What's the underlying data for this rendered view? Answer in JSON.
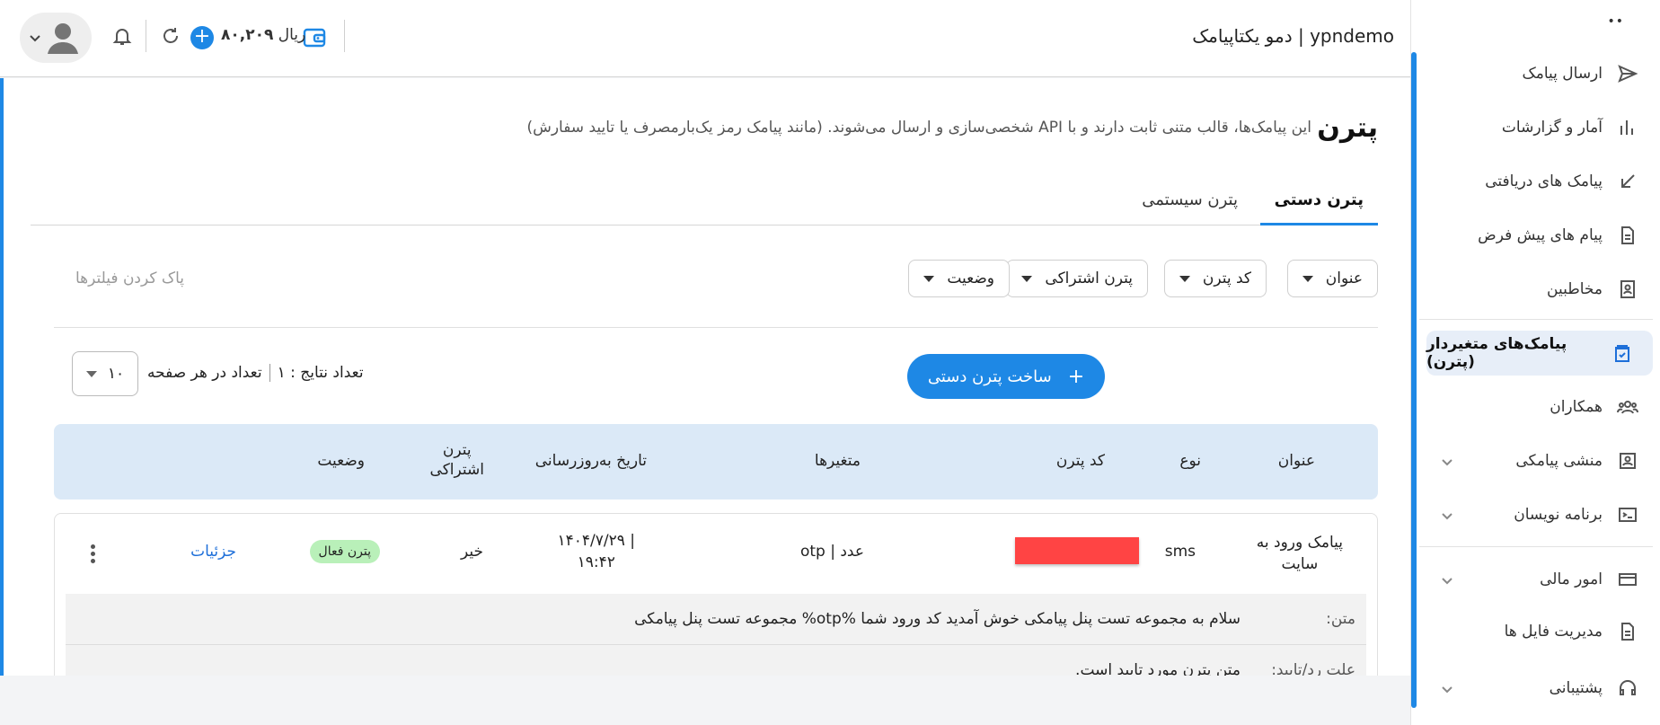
{
  "header": {
    "brand": "دمو یکتاپیامک | ypndemo",
    "balance_value": "۸۰,۲۰۹",
    "balance_unit": "ریال"
  },
  "sidebar": {
    "items": [
      {
        "label": "ارسال پیامک",
        "icon": "send-icon"
      },
      {
        "label": "آمار و گزارشات",
        "icon": "bar-chart-icon"
      },
      {
        "label": "پیامک های دریافتی",
        "icon": "inbox-arrow-icon"
      },
      {
        "label": "پیام های پیش فرض",
        "icon": "document-icon"
      },
      {
        "label": "مخاطبین",
        "icon": "contact-card-icon"
      },
      {
        "label": "پیامک‌های متغیردار (پترن)",
        "icon": "clipboard-check-icon",
        "active": true
      },
      {
        "label": "همکاران",
        "icon": "users-icon"
      },
      {
        "label": "منشی پیامکی",
        "icon": "assistant-icon",
        "expandable": true
      },
      {
        "label": "برنامه نویسان",
        "icon": "terminal-icon",
        "expandable": true
      },
      {
        "label": "امور مالی",
        "icon": "wallet-icon",
        "expandable": true
      },
      {
        "label": "مدیریت فایل ها",
        "icon": "file-icon"
      },
      {
        "label": "پشتیبانی",
        "icon": "headset-icon",
        "expandable": true
      }
    ]
  },
  "page": {
    "title": "پترن",
    "description": "این پیامک‌ها، قالب متنی ثابت دارند و با API شخصی‌سازی و ارسال می‌شوند. (مانند پیامک رمز یک‌بارمصرف یا تایید سفارش)"
  },
  "tabs": [
    {
      "label": "پترن دستی",
      "active": true
    },
    {
      "label": "پترن سیستمی",
      "active": false
    }
  ],
  "filters": {
    "title": "عنوان",
    "code": "کد پترن",
    "shared": "پترن اشتراکی",
    "status": "وضعیت",
    "clear": "پاک کردن فیلترها"
  },
  "toolbar": {
    "create_label": "ساخت پترن دستی",
    "results_label": "تعداد نتایج : ۱",
    "per_page_label": "تعداد در هر صفحه",
    "per_page_value": "۱۰"
  },
  "table": {
    "headers": {
      "title": "عنوان",
      "type": "نوع",
      "code": "کد پترن",
      "variables": "متغیرها",
      "updated": "تاریخ به‌روزرسانی",
      "shared_line1": "پترن",
      "shared_line2": "اشتراکی",
      "status": "وضعیت"
    },
    "row": {
      "title_line1": "پیامک ورود به",
      "title_line2": "سایت",
      "type": "sms",
      "variables": "otp | عدد",
      "updated_line1": "۱۴۰۴/۷/۲۹ |",
      "updated_line2": "۱۹:۴۲",
      "shared": "خیر",
      "status": "پترن فعال",
      "details": "جزئیات",
      "text_key": "متن:",
      "text_value": "سلام به مجموعه تست پنل پیامکی خوش آمدید کد ورود شما %otp% مجموعه تست پنل پیامکی",
      "reason_key": "علت رد/تایید:",
      "reason_value": "متن پترن مورد تایید است."
    }
  },
  "colors": {
    "accent": "#1e88e5",
    "badge_bg": "#b9f0b9",
    "redacted": "#ff4444",
    "table_head": "#dbe9f7"
  }
}
